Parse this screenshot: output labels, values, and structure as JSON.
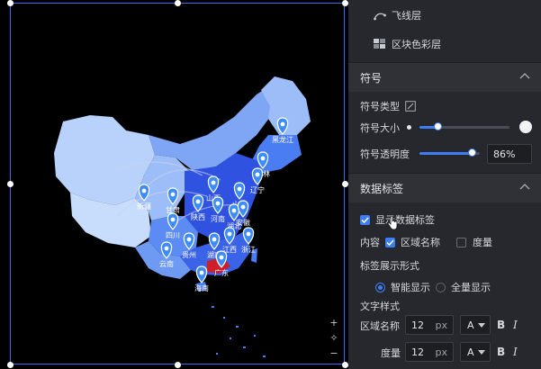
{
  "layers": [
    {
      "label": "飞线层",
      "icon": "flyline-icon"
    },
    {
      "label": "区块色彩层",
      "icon": "block-color-icon"
    }
  ],
  "symbol": {
    "title": "符号",
    "type_label": "符号类型",
    "size_label": "符号大小",
    "size_value": 0.2,
    "opacity_label": "符号透明度",
    "opacity_value": "86%",
    "opacity_fraction": 0.86
  },
  "data_label": {
    "title": "数据标签",
    "show_label": "显示数据标签",
    "content_label": "内容",
    "content_options": [
      {
        "label": "区域名称",
        "checked": true
      },
      {
        "label": "度量",
        "checked": false
      }
    ],
    "display_mode_label": "标签展示形式",
    "display_modes": [
      {
        "label": "智能显示",
        "selected": true
      },
      {
        "label": "全量显示",
        "selected": false
      }
    ],
    "text_style_label": "文字样式",
    "text_rows": [
      {
        "label": "区域名称",
        "size": "12",
        "unit": "px",
        "font": "A",
        "bold": "B",
        "italic": "I"
      },
      {
        "label": "度量",
        "size": "12",
        "unit": "px",
        "font": "A",
        "bold": "B",
        "italic": "I"
      }
    ]
  },
  "map": {
    "pins": [
      {
        "label": "黑龙江"
      },
      {
        "label": "吉林"
      },
      {
        "label": "辽宁"
      },
      {
        "label": "新疆"
      },
      {
        "label": "甘肃"
      },
      {
        "label": "山西"
      },
      {
        "label": "陕西"
      },
      {
        "label": "山东"
      },
      {
        "label": "河南"
      },
      {
        "label": "四川"
      },
      {
        "label": "湖北"
      },
      {
        "label": "安徽"
      },
      {
        "label": "浙江"
      },
      {
        "label": "贵州"
      },
      {
        "label": "湖南"
      },
      {
        "label": "江西"
      },
      {
        "label": "云南"
      },
      {
        "label": "广东"
      },
      {
        "label": "海南"
      }
    ],
    "controls": {
      "zoom_in": "+",
      "locate": "✧",
      "zoom_out": "−"
    }
  },
  "colors": {
    "accent": "#3d7ef5",
    "panel_bg": "#26282d",
    "region_dark": "#2f52e0",
    "region_mid": "#4a7cf2",
    "region_light": "#8db3f7",
    "region_pale": "#b9d2fb",
    "region_red": "#cc1f2a"
  }
}
